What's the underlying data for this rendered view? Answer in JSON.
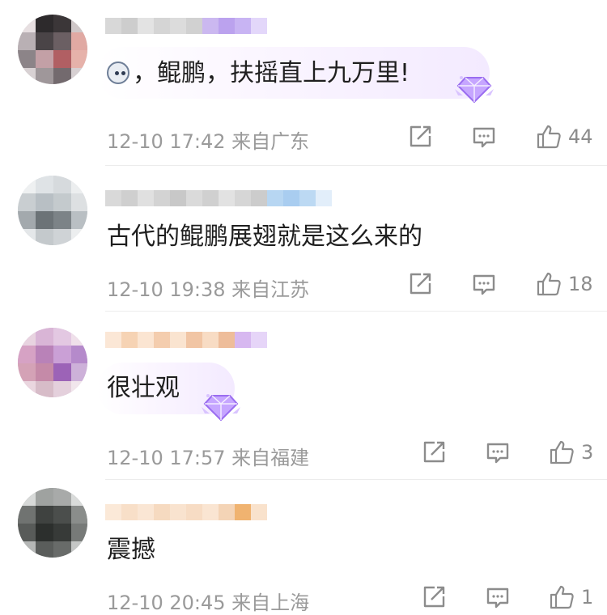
{
  "comments": [
    {
      "text": "，鲲鹏，扶摇直上九万里!",
      "has_emoji": true,
      "emoji_icon": "face-emoji",
      "time": "12-10 17:42",
      "location": "来自广东",
      "likes": "44",
      "badge": true
    },
    {
      "text": "古代的鲲鹏展翅就是这么来的",
      "has_emoji": false,
      "time": "12-10 19:38",
      "location": "来自江苏",
      "likes": "18",
      "badge": false
    },
    {
      "text": "很壮观",
      "has_emoji": false,
      "time": "12-10 17:57",
      "location": "来自福建",
      "likes": "3",
      "badge": true
    },
    {
      "text": "震撼",
      "has_emoji": false,
      "time": "12-10 20:45",
      "location": "来自上海",
      "likes": "1",
      "badge": false
    }
  ],
  "icons": {
    "share": "share-icon",
    "comment": "comment-icon",
    "like": "thumbs-up-icon",
    "badge": "diamond-badge-icon"
  },
  "colors": {
    "text": "#1f1f1f",
    "meta": "#9a9a9a",
    "badge": "#b58cff"
  }
}
